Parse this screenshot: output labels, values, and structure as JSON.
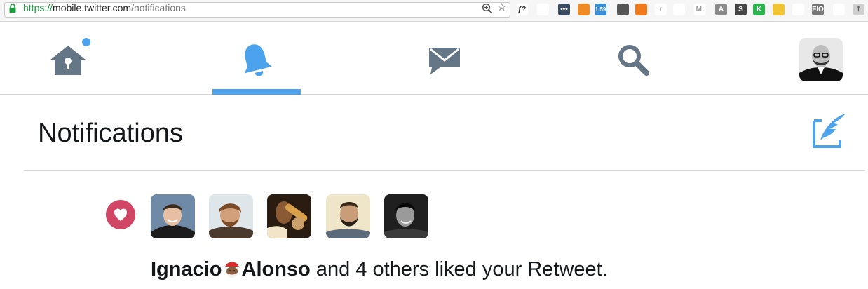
{
  "browser": {
    "url_scheme": "https://",
    "url_host": "mobile.twitter.com",
    "url_path": "/notifications",
    "extensions": [
      {
        "icon": "f-icon",
        "label": "ƒ?",
        "color": "#ffffff",
        "text_color": "#222222"
      },
      {
        "icon": "color-wheel-icon",
        "label": "",
        "color": "#ffffff",
        "text_color": "#222222"
      },
      {
        "icon": "dots-icon",
        "label": "•••",
        "color": "#3b4b5f",
        "text_color": "#ffffff"
      },
      {
        "icon": "chart-icon",
        "label": "",
        "color": "#f08a24",
        "text_color": "#ffffff"
      },
      {
        "icon": "badge-icon",
        "label": "1.59",
        "color": "#3b8fd6",
        "text_color": "#ffffff"
      },
      {
        "icon": "mask-icon",
        "label": "",
        "color": "#555555",
        "text_color": "#ffffff"
      },
      {
        "icon": "circle-x-icon",
        "label": "",
        "color": "#f07b1f",
        "text_color": "#ffffff"
      },
      {
        "icon": "r-icon",
        "label": "r",
        "color": "#ffffff",
        "text_color": "#888888"
      },
      {
        "icon": "person-icon",
        "label": "",
        "color": "#ffffff",
        "text_color": "#aaaaaa"
      },
      {
        "icon": "m-icon",
        "label": "M:",
        "color": "#ffffff",
        "text_color": "#999999"
      },
      {
        "icon": "angular-icon",
        "label": "A",
        "color": "#8a8a8a",
        "text_color": "#ffffff"
      },
      {
        "icon": "s-icon",
        "label": "S",
        "color": "#444444",
        "text_color": "#ffffff"
      },
      {
        "icon": "k-icon",
        "label": "K",
        "color": "#2bb24c",
        "text_color": "#ffffff"
      },
      {
        "icon": "smiley-icon",
        "label": "",
        "color": "#f2c333",
        "text_color": "#ffffff"
      },
      {
        "icon": "cloud-icon",
        "label": "",
        "color": "#ffffff",
        "text_color": "#aaaaaa"
      },
      {
        "icon": "fio-icon",
        "label": "FIO",
        "color": "#777777",
        "text_color": "#ffffff"
      },
      {
        "icon": "doc-icon",
        "label": "",
        "color": "#ffffff",
        "text_color": "#444444"
      },
      {
        "icon": "ext-icon",
        "label": "ꝉ",
        "color": "#cfcfcf",
        "text_color": "#666666"
      }
    ]
  },
  "nav": {
    "items": [
      {
        "name": "home",
        "icon": "home-icon",
        "active": false,
        "has_dot": true
      },
      {
        "name": "notifications",
        "icon": "bell-icon",
        "active": true
      },
      {
        "name": "messages",
        "icon": "envelope-icon",
        "active": false
      },
      {
        "name": "search",
        "icon": "search-icon",
        "active": false
      }
    ],
    "active_color": "#4aa3ec",
    "inactive_color": "#657786"
  },
  "header": {
    "title": "Notifications",
    "compose_icon": "compose-tweet-icon"
  },
  "notification": {
    "type": "like",
    "icon": "heart-icon",
    "icon_color": "#d24665",
    "liker_count": 5,
    "actor_first": "Ignacio",
    "actor_emoji": "santa-emoji",
    "actor_last": "Alonso",
    "text_rest": " and 4 others liked your Retweet."
  }
}
